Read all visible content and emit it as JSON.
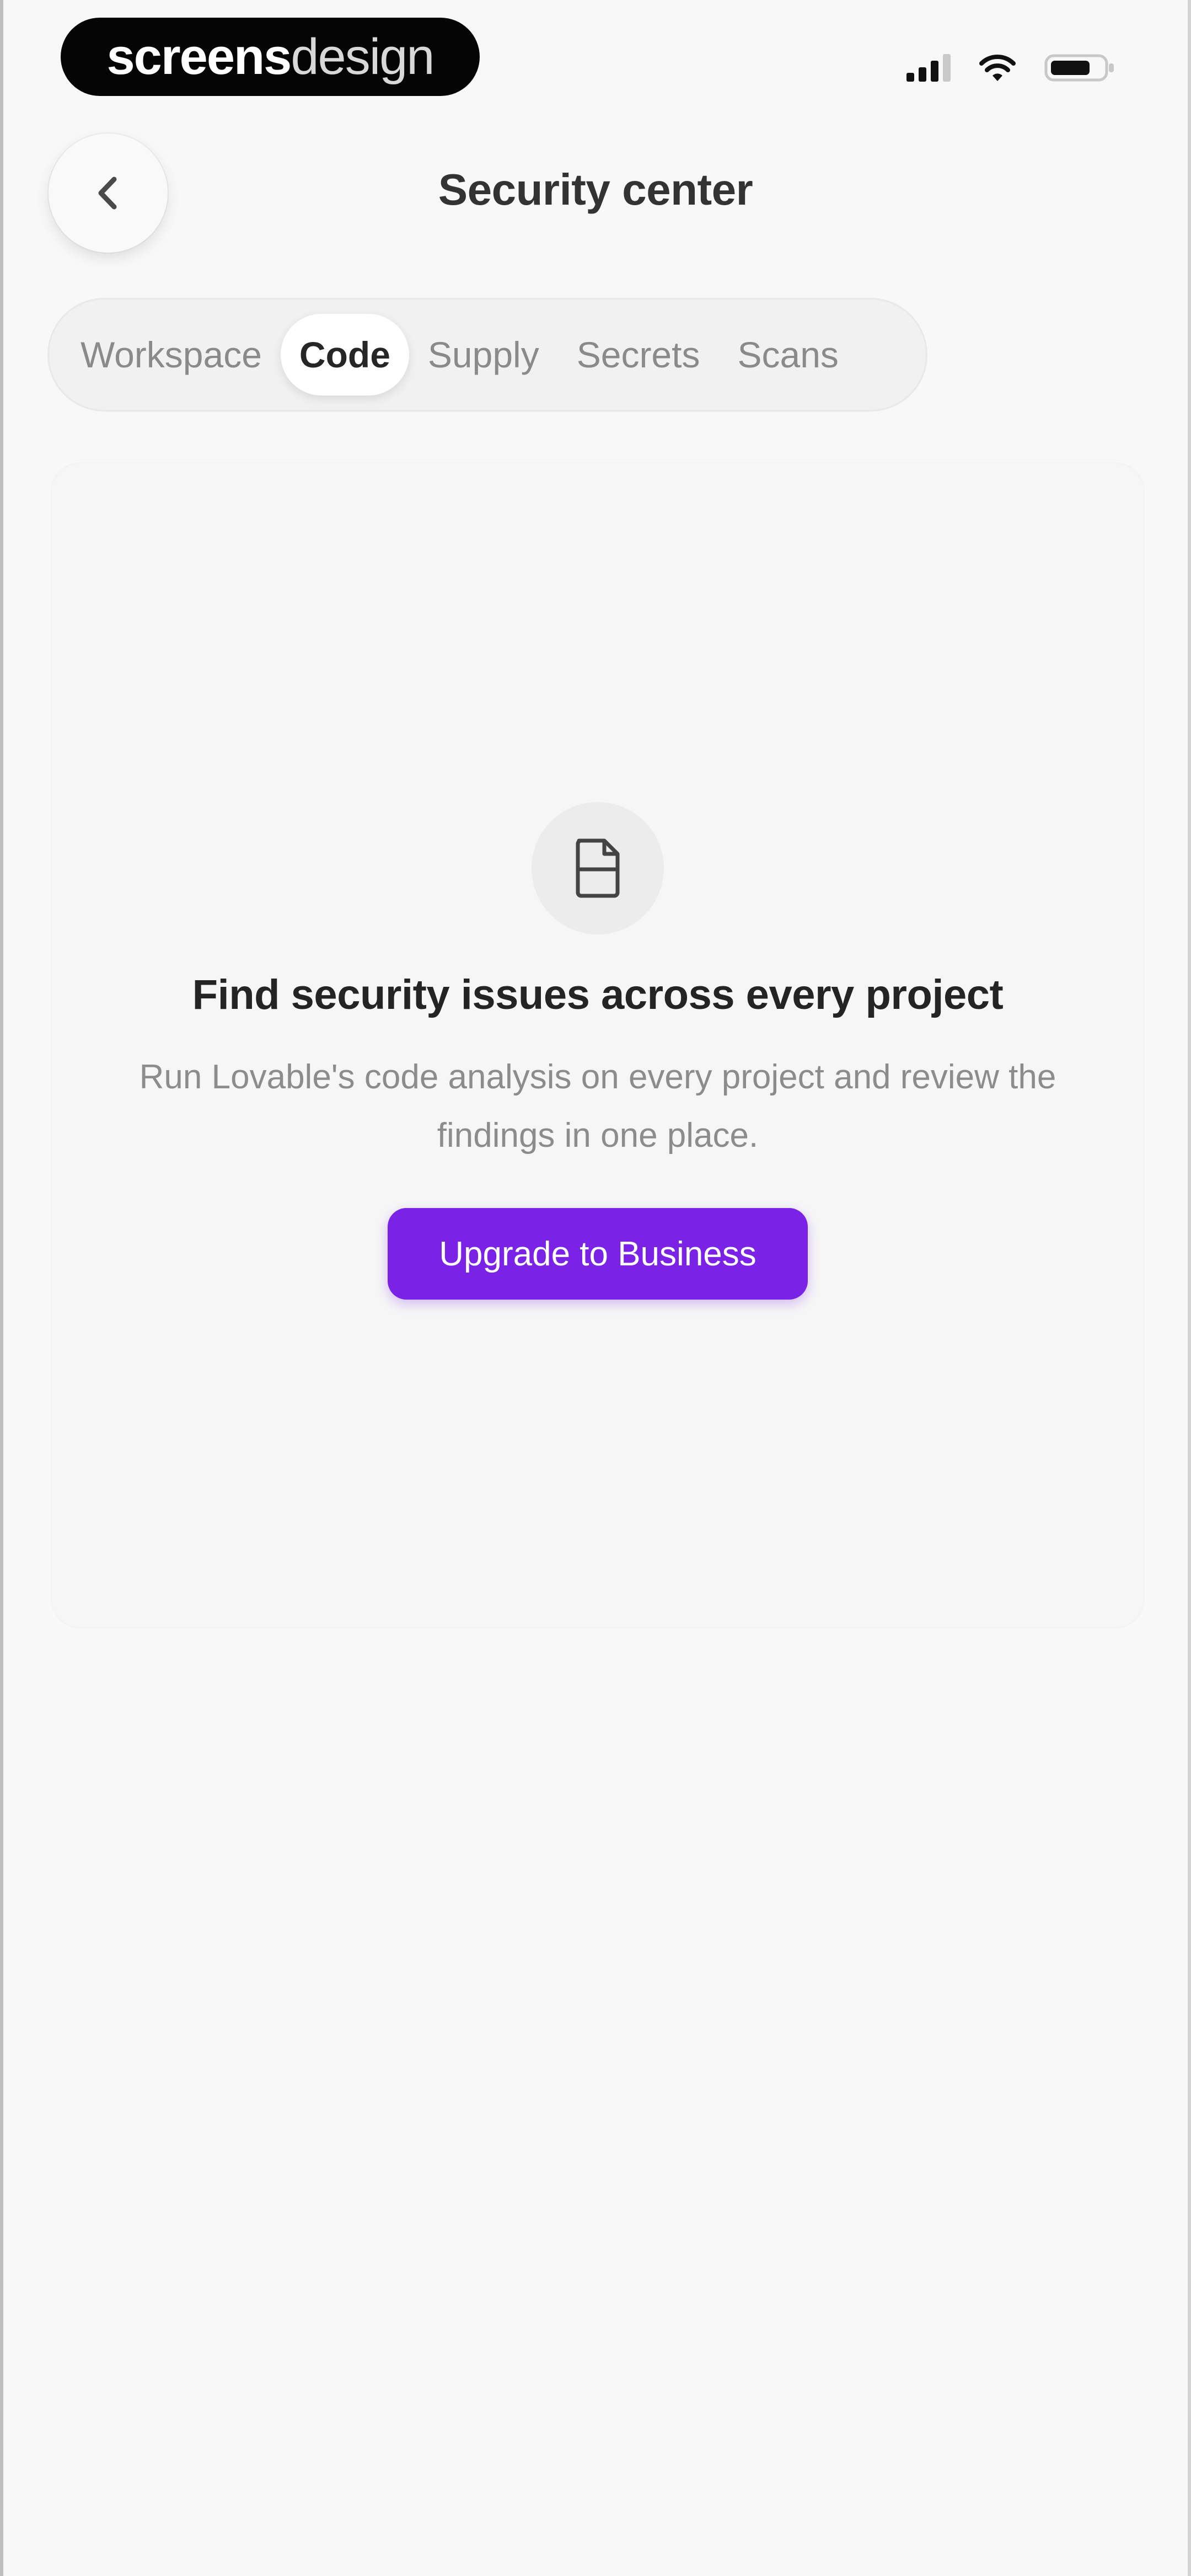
{
  "status_bar": {
    "brand_part_1": "screens",
    "brand_part_2": "design",
    "icons": [
      "signal-icon",
      "wifi-icon",
      "battery-icon"
    ]
  },
  "header": {
    "title": "Security center",
    "back_icon": "chevron-left-icon"
  },
  "tabs": [
    {
      "label": "Workspace",
      "active": false
    },
    {
      "label": "Code",
      "active": true
    },
    {
      "label": "Supply",
      "active": false
    },
    {
      "label": "Secrets",
      "active": false
    },
    {
      "label": "Scans",
      "active": false
    }
  ],
  "empty_state": {
    "icon": "document-icon",
    "title": "Find security issues across every project",
    "description": "Run Lovable's code analysis on every project and review the findings in one place.",
    "button_label": "Upgrade to Business"
  },
  "colors": {
    "accent": "#7a22e6",
    "background": "#f8f8f8",
    "text_primary": "#242424",
    "text_secondary": "#8c8c8c"
  }
}
